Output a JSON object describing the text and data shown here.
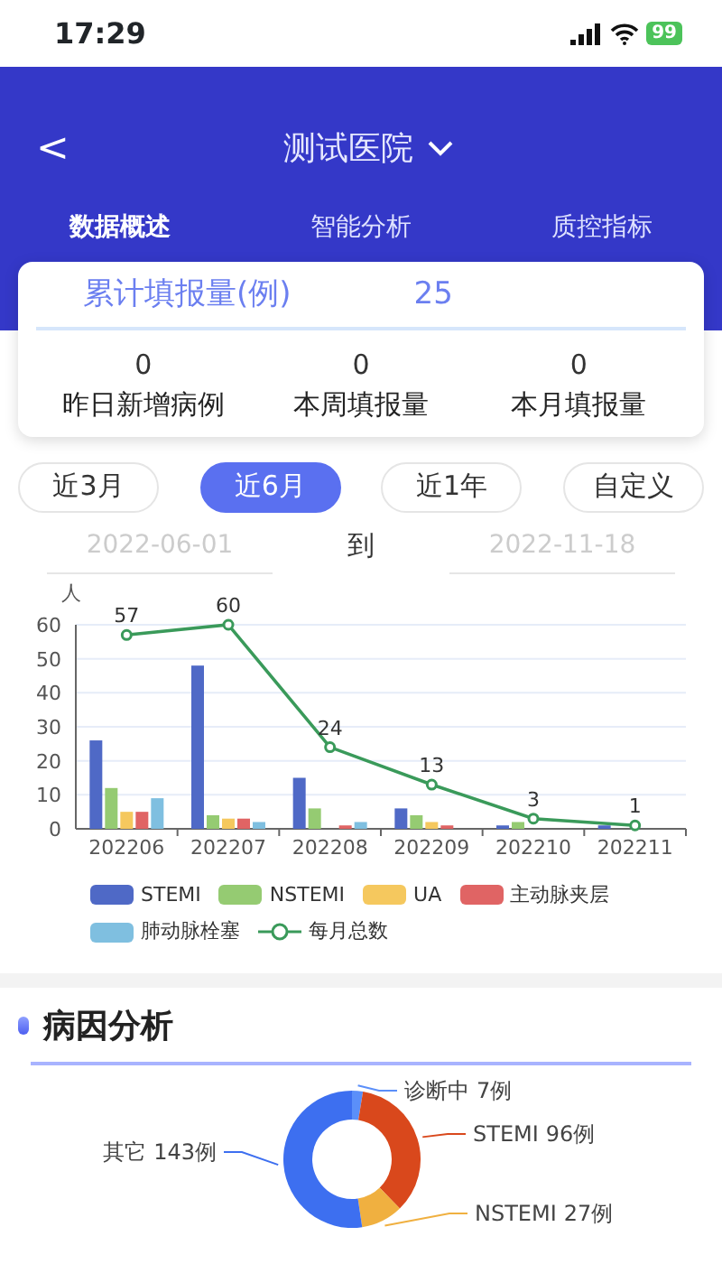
{
  "status_bar": {
    "time": "17:29",
    "battery": "99"
  },
  "header": {
    "back": "<",
    "title": "测试医院"
  },
  "tabs": [
    {
      "label": "数据概述",
      "selected": true
    },
    {
      "label": "智能分析",
      "selected": false
    },
    {
      "label": "质控指标",
      "selected": false
    }
  ],
  "summary": {
    "label": "累计填报量(例)",
    "value": "25",
    "stats": [
      {
        "value": "0",
        "label": "昨日新增病例"
      },
      {
        "value": "0",
        "label": "本周填报量"
      },
      {
        "value": "0",
        "label": "本月填报量"
      }
    ]
  },
  "ranges": [
    {
      "label": "近3月",
      "selected": false
    },
    {
      "label": "近6月",
      "selected": true
    },
    {
      "label": "近1年",
      "selected": false
    },
    {
      "label": "自定义",
      "selected": false
    }
  ],
  "date_range": {
    "start": "2022-06-01",
    "separator": "到",
    "end": "2022-11-18"
  },
  "trend": {
    "chart_data": {
      "type": "bar",
      "ylabel": "人",
      "categories": [
        "202206",
        "202207",
        "202208",
        "202209",
        "202210",
        "202211"
      ],
      "yticks": [
        0,
        10,
        20,
        30,
        40,
        50,
        60
      ],
      "ylim": [
        0,
        60
      ],
      "grid": true,
      "stacked": false,
      "series": [
        {
          "name": "STEMI",
          "color": "#4f69c6",
          "values": [
            26,
            48,
            15,
            6,
            1,
            1
          ]
        },
        {
          "name": "NSTEMI",
          "color": "#95cb72",
          "values": [
            12,
            4,
            6,
            4,
            2,
            0
          ]
        },
        {
          "name": "UA",
          "color": "#f5c85e",
          "values": [
            5,
            3,
            0,
            2,
            0,
            0
          ]
        },
        {
          "name": "主动脉夹层",
          "color": "#e06464",
          "values": [
            5,
            3,
            1,
            1,
            0,
            0
          ]
        },
        {
          "name": "肺动脉栓塞",
          "color": "#7fbfe0",
          "values": [
            9,
            2,
            2,
            0,
            0,
            0
          ]
        },
        {
          "name": "每月总数",
          "type": "line",
          "color": "#3a9a5a",
          "marker": "circle",
          "values": [
            57,
            60,
            24,
            13,
            3,
            1
          ],
          "value_labels": [
            "57",
            "60",
            "24",
            "13",
            "3",
            "1"
          ]
        }
      ]
    }
  },
  "cause_analysis": {
    "title": "病因分析",
    "chart_data": {
      "type": "donut",
      "categories": [
        "诊断中",
        "STEMI",
        "NSTEMI",
        "其它"
      ],
      "values": [
        7,
        96,
        27,
        143
      ],
      "value_labels": [
        "7例",
        "96例",
        "27例",
        "143例"
      ],
      "colors": [
        "#5b8ff9",
        "#d9481c",
        "#f0b040",
        "#3d6ff0"
      ]
    }
  }
}
